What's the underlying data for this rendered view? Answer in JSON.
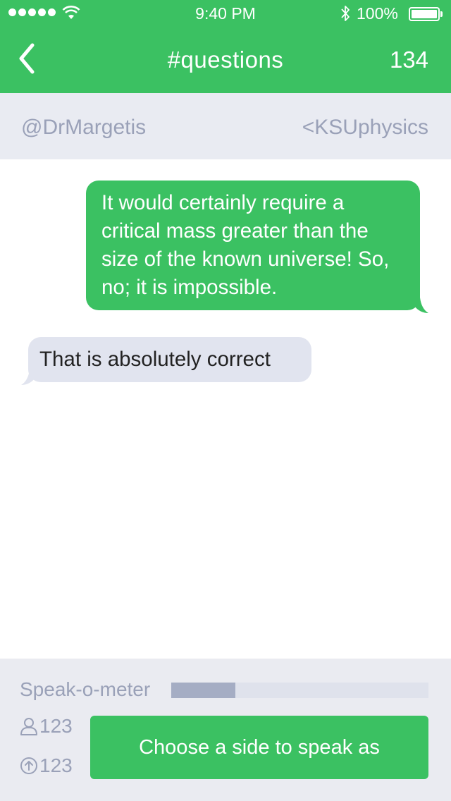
{
  "status_bar": {
    "time": "9:40 PM",
    "battery": "100%"
  },
  "header": {
    "title": "#questions",
    "count": "134"
  },
  "participants": {
    "left": "@DrMargetis",
    "right": "<KSUphysics"
  },
  "messages": [
    {
      "side": "right",
      "text": "It would certainly require a critical mass greater than the size of the known universe! So, no; it is impossible."
    },
    {
      "side": "left",
      "text": "That is absolutely correct"
    }
  ],
  "footer": {
    "meter_label": "Speak-o-meter",
    "meter_level_percent": 25,
    "listeners": "123",
    "upvotes": "123",
    "speak_button": "Choose a side to speak as"
  },
  "colors": {
    "accent": "#3bc162",
    "panel": "#e9ebf2",
    "muted_text": "#9aa1b8"
  }
}
